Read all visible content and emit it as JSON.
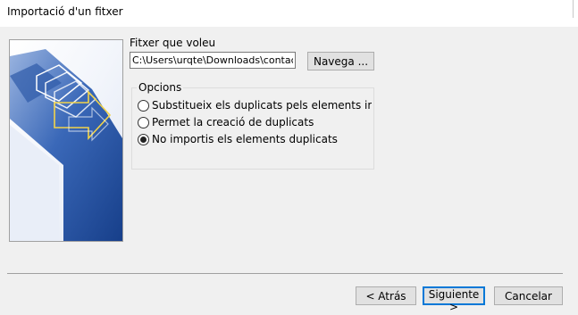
{
  "window": {
    "title": "Importació d'un fitxer"
  },
  "file": {
    "label": "Fitxer que voleu",
    "path_value": "C:\\Users\\urqte\\Downloads\\contacts",
    "browse_label": "Navega ..."
  },
  "options": {
    "legend": "Opcions",
    "items": [
      {
        "label": "Substitueix els duplicats pels elements importa",
        "checked": false
      },
      {
        "label": "Permet la creació de duplicats",
        "checked": false
      },
      {
        "label": "No importis els elements duplicats",
        "checked": true
      }
    ]
  },
  "footer": {
    "back_label": "< Atrás",
    "next_label": "Siguiente >",
    "cancel_label": "Cancelar"
  },
  "colors": {
    "accent": "#0078d7",
    "image_blue_dark": "#1d4a9c",
    "image_blue_light": "#6f93cf",
    "arrow_yellow": "#f2d34a"
  }
}
